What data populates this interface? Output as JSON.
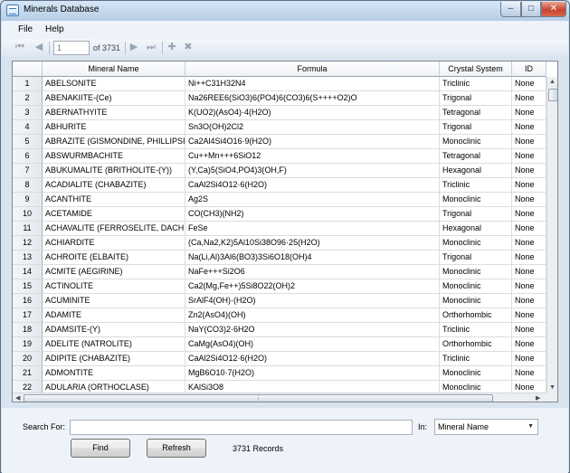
{
  "window": {
    "title": "Minerals Database",
    "min": "–",
    "max": "□",
    "close": "✕"
  },
  "menu": [
    "File",
    "Help"
  ],
  "toolbar": {
    "page": "1",
    "of_label": "of 3731",
    "first": "⏮",
    "prev": "◀",
    "next": "▶",
    "last": "⏭",
    "add": "✚",
    "delete": "✖"
  },
  "grid": {
    "columns": [
      "",
      "Mineral Name",
      "Formula",
      "Crystal System",
      "ID"
    ],
    "rows": [
      [
        "1",
        "ABELSONITE",
        "Ni++C31H32N4",
        "Triclinic",
        "None"
      ],
      [
        "2",
        "ABENAKIITE-(Ce)",
        "Na26REE6(SiO3)6(PO4)6(CO3)6(S++++O2)O",
        "Trigonal",
        "None"
      ],
      [
        "3",
        "ABERNATHYITE",
        "K(UO2)(AsO4)·4(H2O)",
        "Tetragonal",
        "None"
      ],
      [
        "4",
        "ABHURITE",
        "Sn3O(OH)2Cl2",
        "Trigonal",
        "None"
      ],
      [
        "5",
        "ABRAZITE (GISMONDINE, PHILLIPSITE)",
        "Ca2Al4Si4O16·9(H2O)",
        "Monoclinic",
        "None"
      ],
      [
        "6",
        "ABSWURMBACHITE",
        "Cu++Mn+++6SiO12",
        "Tetragonal",
        "None"
      ],
      [
        "7",
        "ABUKUMALITE (BRITHOLITE-(Y))",
        "(Y,Ca)5(SiO4,PO4)3(OH,F)",
        "Hexagonal",
        "None"
      ],
      [
        "8",
        "ACADIALITE (CHABAZITE)",
        "CaAl2Si4O12·6(H2O)",
        "Triclinic",
        "None"
      ],
      [
        "9",
        "ACANTHITE",
        "Ag2S",
        "Monoclinic",
        "None"
      ],
      [
        "10",
        "ACETAMIDE",
        "CO(CH3)(NH2)",
        "Trigonal",
        "None"
      ],
      [
        "11",
        "ACHAVALITE (FERROSELITE, DACHIARD",
        "FeSe",
        "Hexagonal",
        "None"
      ],
      [
        "12",
        "ACHIARDITE",
        "(Ca,Na2,K2)5Al10Si38O96·25(H2O)",
        "Monoclinic",
        "None"
      ],
      [
        "13",
        "ACHROITE (ELBAITE)",
        "Na(Li,Al)3Al6(BO3)3Si6O18(OH)4",
        "Trigonal",
        "None"
      ],
      [
        "14",
        "ACMITE (AEGIRINE)",
        "NaFe+++Si2O6",
        "Monoclinic",
        "None"
      ],
      [
        "15",
        "ACTINOLITE",
        "Ca2(Mg,Fe++)5Si8O22(OH)2",
        "Monoclinic",
        "None"
      ],
      [
        "16",
        "ACUMINITE",
        "SrAlF4(OH)·(H2O)",
        "Monoclinic",
        "None"
      ],
      [
        "17",
        "ADAMITE",
        "Zn2(AsO4)(OH)",
        "Orthorhombic",
        "None"
      ],
      [
        "18",
        "ADAMSITE-(Y)",
        "NaY(CO3)2·6H2O",
        "Triclinic",
        "None"
      ],
      [
        "19",
        "ADELITE (NATROLITE)",
        "CaMg(AsO4)(OH)",
        "Orthorhombic",
        "None"
      ],
      [
        "20",
        "ADIPITE (CHABAZITE)",
        "CaAl2Si4O12·6(H2O)",
        "Triclinic",
        "None"
      ],
      [
        "21",
        "ADMONTITE",
        "MgB6O10·7(H2O)",
        "Monoclinic",
        "None"
      ],
      [
        "22",
        "ADULARIA (ORTHOCLASE)",
        "KAlSi3O8",
        "Monoclinic",
        "None"
      ]
    ]
  },
  "search": {
    "label": "Search For:",
    "value": "",
    "in_label": "In:",
    "field": "Mineral Name"
  },
  "buttons": {
    "find": "Find",
    "refresh": "Refresh"
  },
  "status": "3731 Records"
}
